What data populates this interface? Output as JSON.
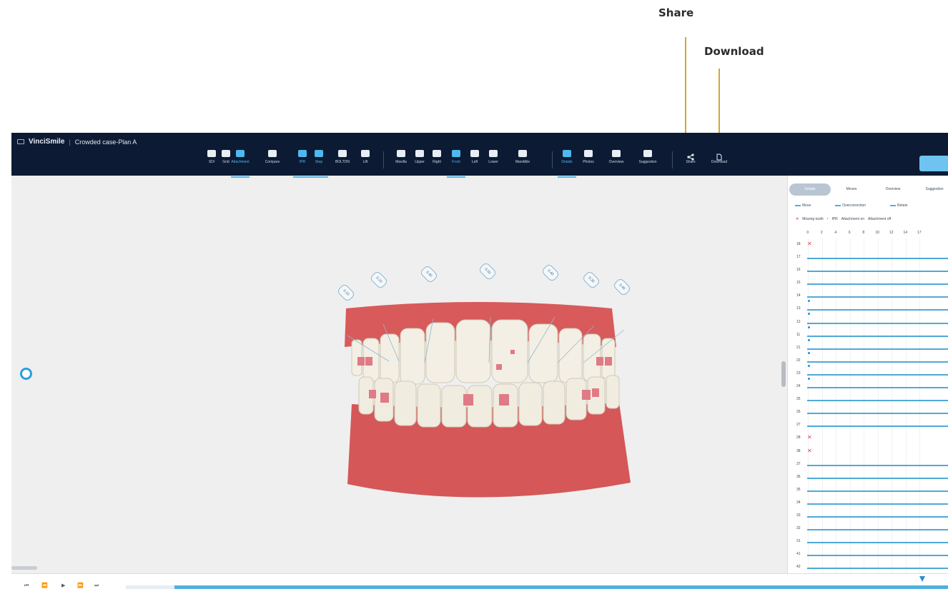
{
  "callouts": {
    "share": "Share",
    "download": "Download"
  },
  "titlebar": {
    "app_name": "VinciSmile",
    "separator": "|",
    "case_title": "Crowded case-Plan A"
  },
  "toolbar": {
    "view_tools": [
      {
        "label": "SDI",
        "active": false
      },
      {
        "label": "Grid",
        "active": false
      },
      {
        "label": "Attachment",
        "active": true
      },
      {
        "label": "Compare",
        "active": false
      },
      {
        "label": "IPR",
        "active": true
      },
      {
        "label": "Step",
        "active": true
      },
      {
        "label": "BOLTON",
        "active": false
      },
      {
        "label": "Lift",
        "active": false
      }
    ],
    "orientation_tools": [
      {
        "label": "Maxilla"
      },
      {
        "label": "Upper"
      },
      {
        "label": "Right"
      },
      {
        "label": "Front",
        "active": true
      },
      {
        "label": "Left"
      },
      {
        "label": "Lower"
      },
      {
        "label": "Mandible"
      }
    ],
    "panel_tools": [
      {
        "label": "Details",
        "active": true
      },
      {
        "label": "Photos"
      },
      {
        "label": "Overview"
      },
      {
        "label": "Suggestion"
      }
    ],
    "share_label": "Share",
    "download_label": "Download"
  },
  "viewport": {
    "ipr_values": [
      "0.10",
      "0.10",
      "0.40",
      "0.50",
      "0.40",
      "0.30",
      "0.40"
    ]
  },
  "panel": {
    "tabs": [
      "Details",
      "Moves",
      "Overview",
      "Suggestion"
    ],
    "legend_lines": [
      "Move",
      "Overcorrection",
      "Retain"
    ],
    "legend_marks": [
      "Missing tooth",
      "IPR",
      "Attachment on",
      "Attachment off"
    ],
    "scale": [
      "0",
      "2",
      "4",
      "6",
      "8",
      "10",
      "12",
      "14",
      "17"
    ],
    "rows": [
      {
        "tooth": "18",
        "missing": true
      },
      {
        "tooth": "17"
      },
      {
        "tooth": "16"
      },
      {
        "tooth": "15"
      },
      {
        "tooth": "14"
      },
      {
        "tooth": "13"
      },
      {
        "tooth": "12"
      },
      {
        "tooth": "11"
      },
      {
        "tooth": "21"
      },
      {
        "tooth": "22"
      },
      {
        "tooth": "23"
      },
      {
        "tooth": "24"
      },
      {
        "tooth": "25"
      },
      {
        "tooth": "26"
      },
      {
        "tooth": "27"
      },
      {
        "tooth": "28",
        "missing": true
      },
      {
        "tooth": "38",
        "missing": true
      },
      {
        "tooth": "37"
      },
      {
        "tooth": "36"
      },
      {
        "tooth": "35"
      },
      {
        "tooth": "34"
      },
      {
        "tooth": "33"
      },
      {
        "tooth": "32"
      },
      {
        "tooth": "31"
      },
      {
        "tooth": "41"
      },
      {
        "tooth": "42"
      }
    ]
  },
  "colors": {
    "topbar_bg": "#0c1b33",
    "accent": "#4fb8ee",
    "callout": "#d5a53a",
    "missing": "#e0414f",
    "gum": "#d85a5a",
    "tooth": "#f3efe4"
  }
}
